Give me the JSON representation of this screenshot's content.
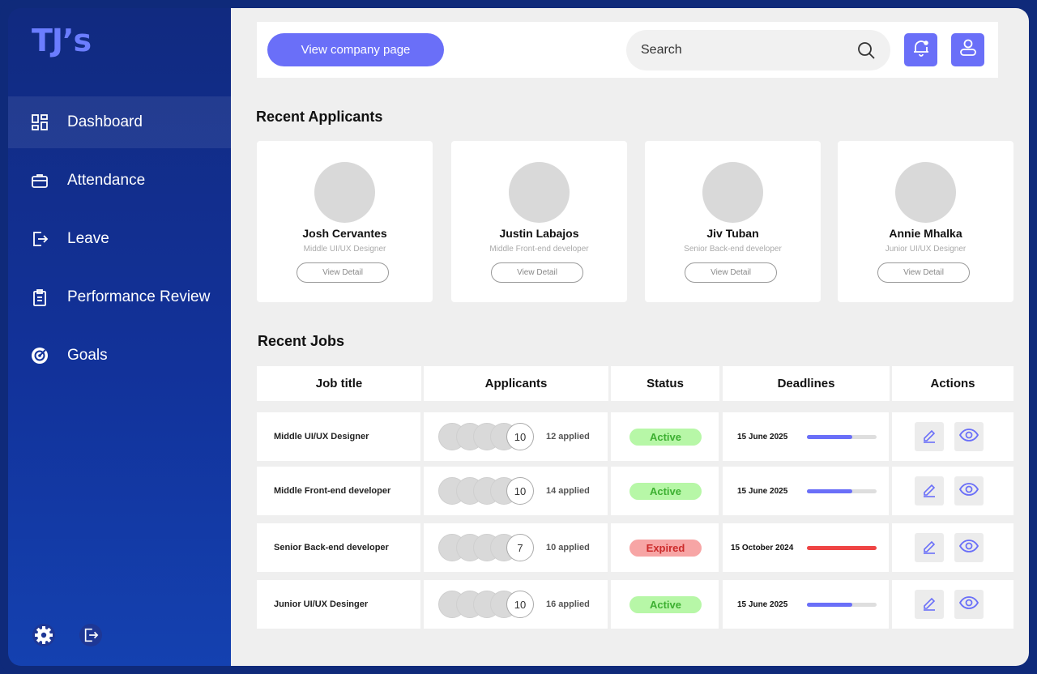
{
  "brand": {
    "logo": "TJ’s",
    "accent": "#6a6ff8"
  },
  "sidebar": {
    "items": [
      {
        "label": "Dashboard",
        "icon": "dashboard-icon",
        "active": true
      },
      {
        "label": "Attendance",
        "icon": "briefcase-icon",
        "active": false
      },
      {
        "label": "Leave",
        "icon": "exit-door-icon",
        "active": false
      },
      {
        "label": "Performance Review",
        "icon": "clipboard-icon",
        "active": false
      },
      {
        "label": "Goals",
        "icon": "target-icon",
        "active": false
      }
    ],
    "bottom_icons": [
      "gear-icon",
      "logout-icon"
    ]
  },
  "header": {
    "company_button": "View company page",
    "search_placeholder": "Search",
    "icons": [
      "search-icon",
      "bell-icon",
      "user-icon"
    ]
  },
  "recent_applicants": {
    "title": "Recent Applicants",
    "detail_label": "View Detail",
    "cards": [
      {
        "name": "Josh Cervantes",
        "role": "Middle UI/UX Designer"
      },
      {
        "name": "Justin Labajos",
        "role": "Middle Front-end developer"
      },
      {
        "name": "Jiv Tuban",
        "role": "Senior Back-end developer"
      },
      {
        "name": "Annie Mhalka",
        "role": "Junior UI/UX Designer"
      }
    ]
  },
  "recent_jobs": {
    "title": "Recent Jobs",
    "columns": [
      "Job title",
      "Applicants",
      "Status",
      "Deadlines",
      "Actions"
    ],
    "rows": [
      {
        "job": "Middle UI/UX Designer",
        "count": "10",
        "applied": "12 applied",
        "status": "Active",
        "status_type": "active",
        "deadline": "15 June 2025",
        "progress": 0.65,
        "bar_color": "#6a6ff8"
      },
      {
        "job": "Middle Front-end developer",
        "count": "10",
        "applied": "14 applied",
        "status": "Active",
        "status_type": "active",
        "deadline": "15 June 2025",
        "progress": 0.65,
        "bar_color": "#6a6ff8"
      },
      {
        "job": "Senior Back-end developer",
        "count": "7",
        "applied": "10 applied",
        "status": "Expired",
        "status_type": "expired",
        "deadline": "15 October 2024",
        "progress": 1.0,
        "bar_color": "#ef4444"
      },
      {
        "job": "Junior UI/UX Desinger",
        "count": "10",
        "applied": "16 applied",
        "status": "Active",
        "status_type": "active",
        "deadline": "15 June 2025",
        "progress": 0.65,
        "bar_color": "#6a6ff8"
      }
    ]
  }
}
